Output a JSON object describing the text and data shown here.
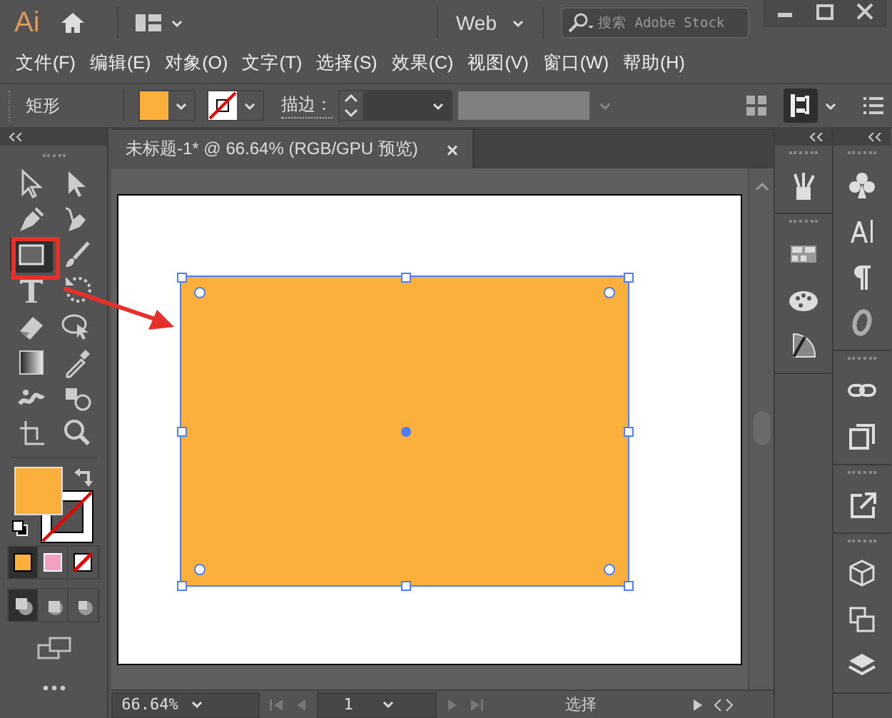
{
  "app": {
    "logo": "Ai",
    "workspace": "Web",
    "search": {
      "placeholder": "搜索 Adobe Stock"
    }
  },
  "menu": [
    "文件(F)",
    "编辑(E)",
    "对象(O)",
    "文字(T)",
    "选择(S)",
    "效果(C)",
    "视图(V)",
    "窗口(W)",
    "帮助(H)"
  ],
  "control_bar": {
    "label": "矩形",
    "fill": {
      "color": "#fbb03b"
    },
    "stroke_label": "描边："
  },
  "document_tab": {
    "title": "未标题-1* @ 66.64% (RGB/GPU 预览)",
    "close": "×",
    "selected": true
  },
  "tools": [
    {
      "kind": "selection",
      "selected": false
    },
    {
      "kind": "direct",
      "selected": false
    },
    {
      "kind": "pen",
      "selected": false
    },
    {
      "kind": "curvature",
      "selected": false
    },
    {
      "kind": "rectangle",
      "selected": true
    },
    {
      "kind": "brush",
      "selected": false
    },
    {
      "kind": "type",
      "selected": false
    },
    {
      "kind": "rotate",
      "selected": false
    },
    {
      "kind": "eraser",
      "selected": false
    },
    {
      "kind": "lasso",
      "selected": false
    },
    {
      "kind": "gradient",
      "selected": false
    },
    {
      "kind": "eyedropper",
      "selected": false
    },
    {
      "kind": "warp",
      "selected": false
    },
    {
      "kind": "shapes",
      "selected": false
    },
    {
      "kind": "artboard",
      "selected": false
    },
    {
      "kind": "zoom",
      "selected": false
    }
  ],
  "color_modes": [
    {
      "kind": "color",
      "selected": true
    },
    {
      "kind": "gradient",
      "selected": false
    },
    {
      "kind": "none",
      "selected": false
    }
  ],
  "draw_modes": [
    {
      "kind": "normal",
      "selected": true
    },
    {
      "kind": "behind",
      "selected": false
    },
    {
      "kind": "inside",
      "selected": false
    }
  ],
  "canvas": {
    "shape_selected": true
  },
  "status_bar": {
    "zoom": "66.64%",
    "page": "1",
    "tool_name": "选择"
  }
}
